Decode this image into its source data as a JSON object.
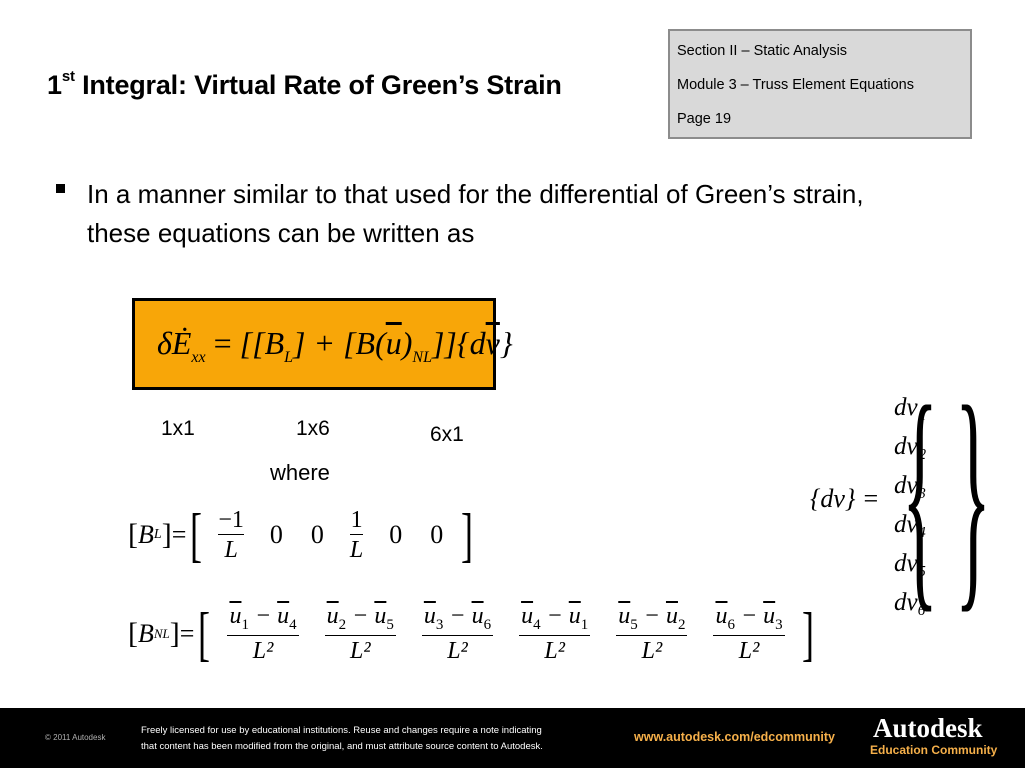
{
  "header": {
    "title_prefix": "1",
    "title_sup": "st",
    "title_rest": " Integral: Virtual Rate of Green’s Strain",
    "info": {
      "section": "Section II – Static Analysis",
      "module": "Module 3 – Truss Element Equations",
      "page": "Page 19"
    }
  },
  "body": {
    "bullet_text": "In a manner similar to that used for the differential of Green’s strain, these equations can be written as",
    "main_equation": {
      "lhs": "δĖ",
      "lhs_sub": "xx",
      "eq": " = ",
      "term1": "[[B",
      "term1_sub": "L",
      "term1_end": "] + [B(",
      "u": "u",
      "term2_mid": ")",
      "term2_sub": "NL",
      "term2_end": "]]{d",
      "v": "v",
      "close": "}"
    },
    "dims": [
      "1x1",
      "1x6",
      "6x1"
    ],
    "where": "where",
    "bl_matrix": {
      "label": "B",
      "label_sub": "L",
      "entries": [
        {
          "num": "−1",
          "den": "L",
          "type": "frac"
        },
        {
          "val": "0",
          "type": "val"
        },
        {
          "val": "0",
          "type": "val"
        },
        {
          "num": "1",
          "den": "L",
          "type": "frac"
        },
        {
          "val": "0",
          "type": "val"
        },
        {
          "val": "0",
          "type": "val"
        }
      ]
    },
    "bnl_matrix": {
      "label": "B",
      "label_sub": "NL",
      "entries": [
        {
          "a": "1",
          "b": "4",
          "den": "L²"
        },
        {
          "a": "2",
          "b": "5",
          "den": "L²"
        },
        {
          "a": "3",
          "b": "6",
          "den": "L²"
        },
        {
          "a": "4",
          "b": "1",
          "den": "L²"
        },
        {
          "a": "5",
          "b": "2",
          "den": "L²"
        },
        {
          "a": "6",
          "b": "3",
          "den": "L²"
        }
      ]
    },
    "dv_vector": {
      "lhs": "{dv} =",
      "items": [
        "dv₁",
        "dv₂",
        "dv₃",
        "dv₄",
        "dv₅",
        "dv₆"
      ]
    }
  },
  "footer": {
    "copyright": "© 2011 Autodesk",
    "license_line1": "Freely licensed for use by educational institutions. Reuse and changes require a note indicating",
    "license_line2": "that content has been modified from the original, and must attribute source content to Autodesk.",
    "url": "www.autodesk.com/edcommunity",
    "brand": "Autodesk",
    "brand_sub": "Education Community"
  }
}
